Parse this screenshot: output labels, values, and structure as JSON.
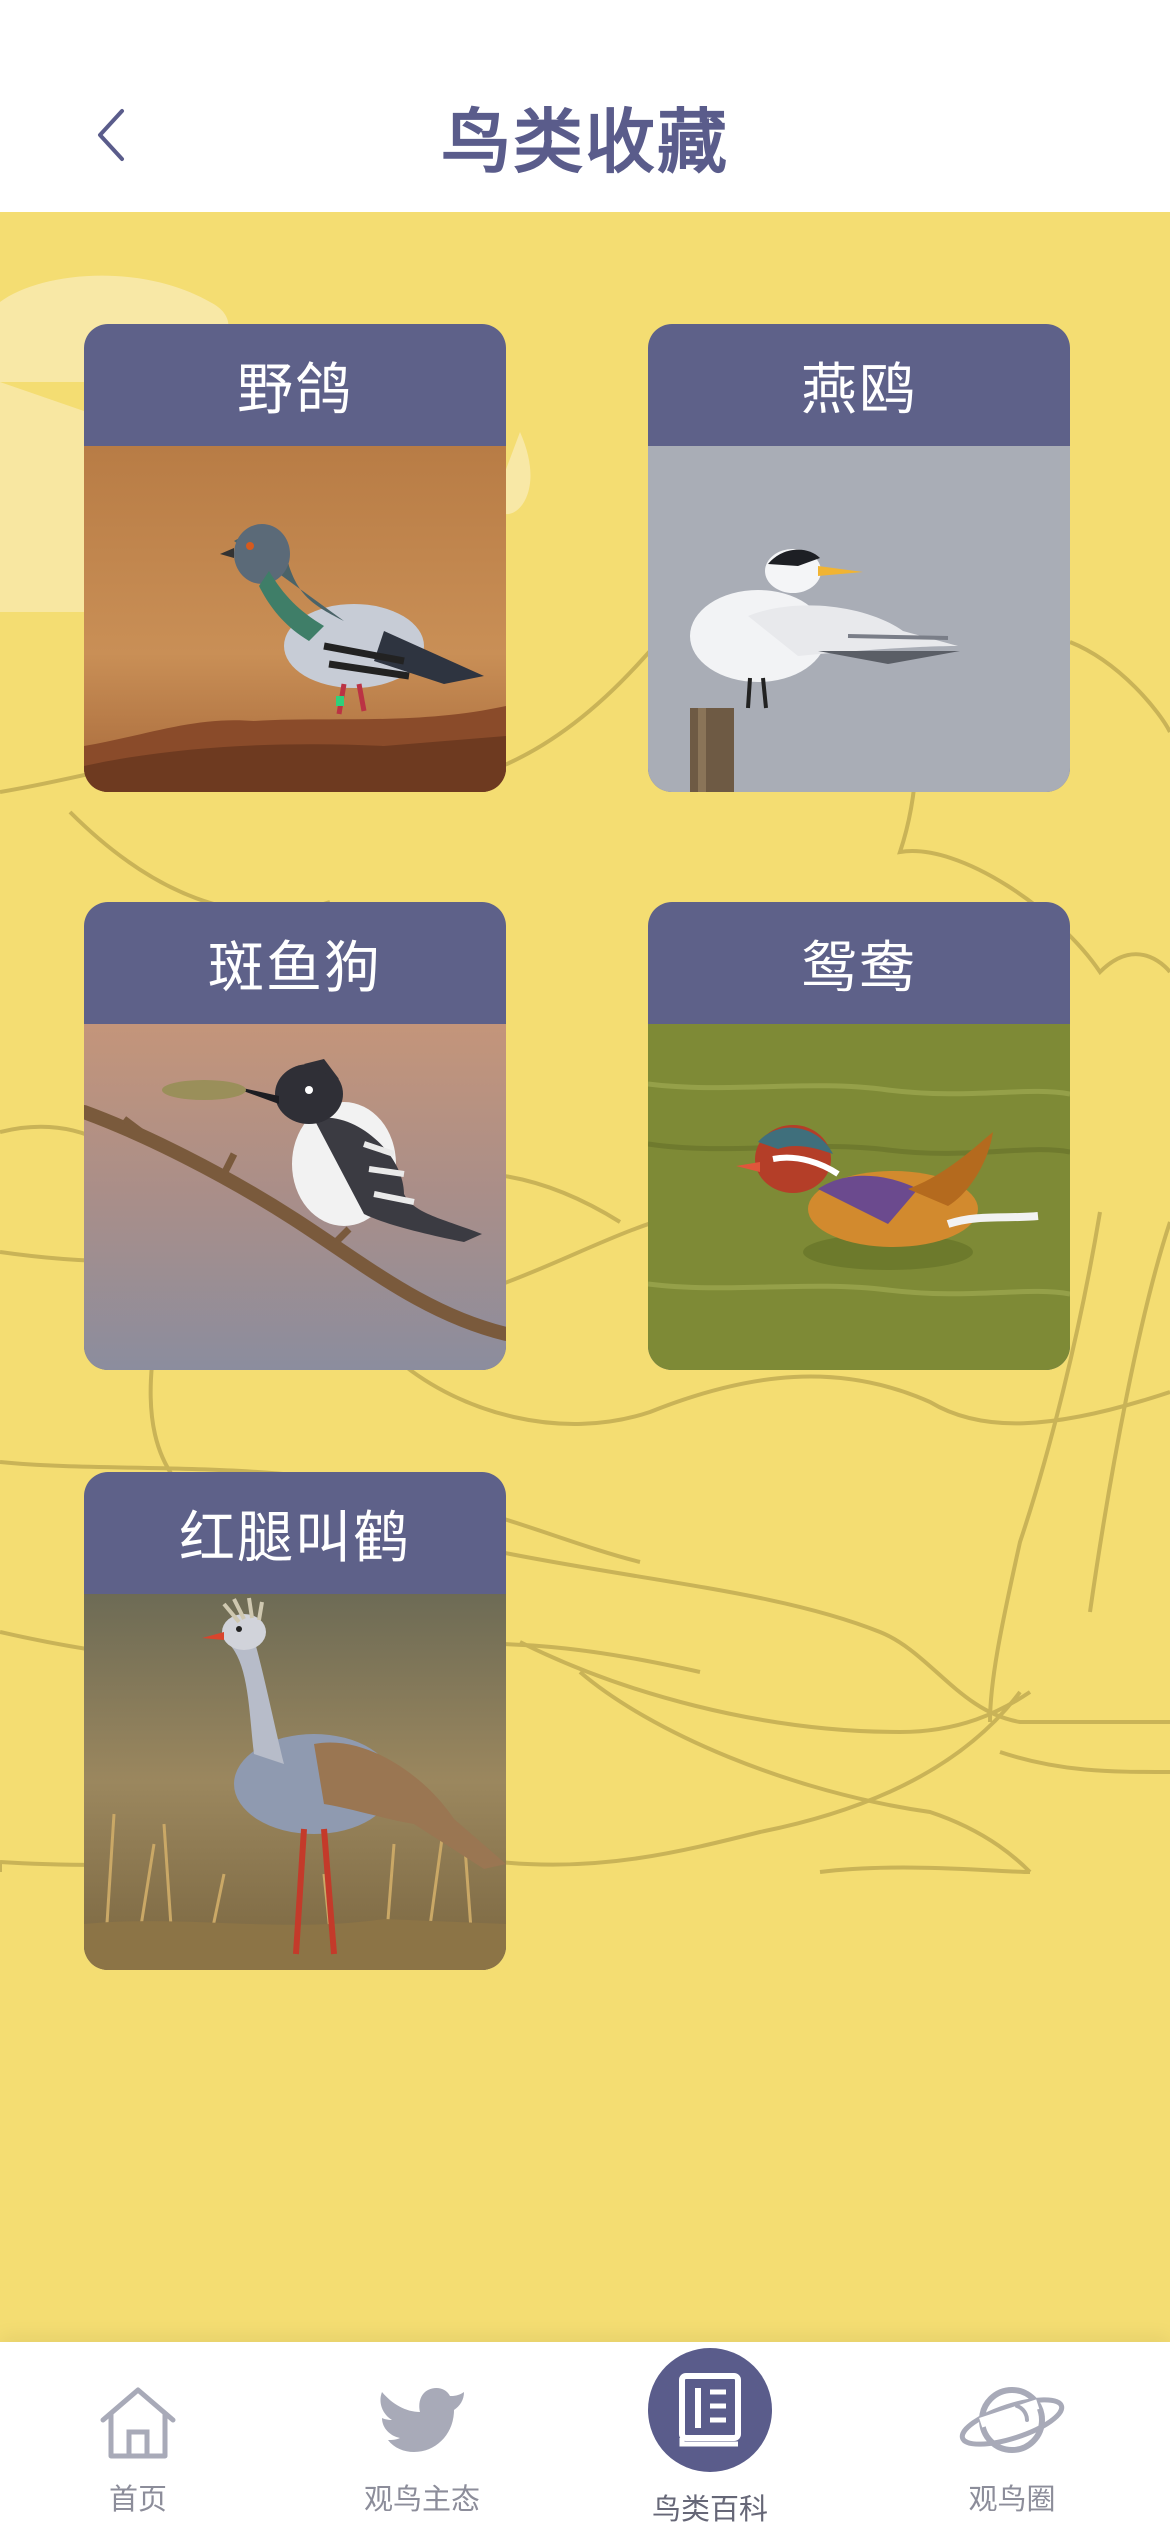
{
  "header": {
    "title": "鸟类收藏",
    "back_icon": "chevron-left-icon"
  },
  "colors": {
    "accent": "#5a5c8b",
    "card_header": "#5e6189",
    "background": "#f4dd72",
    "line_art": "#c9b357"
  },
  "birds": [
    {
      "name": "野鸽",
      "image": "pigeon-photo"
    },
    {
      "name": "燕鸥",
      "image": "tern-photo"
    },
    {
      "name": "斑鱼狗",
      "image": "kingfisher-photo"
    },
    {
      "name": "鸳鸯",
      "image": "mandarin-duck-photo"
    },
    {
      "name": "红腿叫鹤",
      "image": "seriema-photo"
    }
  ],
  "tabbar": [
    {
      "label": "首页",
      "icon": "home-icon",
      "active": false
    },
    {
      "label": "观鸟主态",
      "icon": "bird-icon",
      "active": false
    },
    {
      "label": "鸟类百科",
      "icon": "book-icon",
      "active": true
    },
    {
      "label": "观鸟圈",
      "icon": "planet-icon",
      "active": false
    }
  ]
}
